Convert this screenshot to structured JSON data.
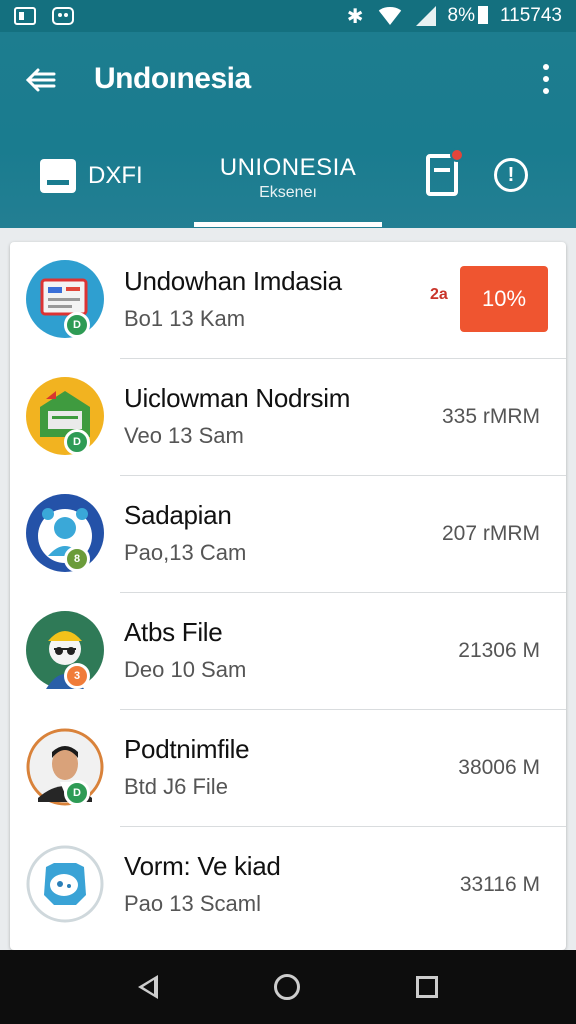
{
  "status_bar": {
    "battery": "8%",
    "time": "115743"
  },
  "app_bar": {
    "title": "Undoınesia"
  },
  "tabs": [
    {
      "label": "DXFI"
    },
    {
      "label": "UNIONESIA",
      "sub": "Ekseneı"
    }
  ],
  "list": [
    {
      "name": "Undowhan Imdasia",
      "date": "Bo1 13 Kam",
      "progress": "10%",
      "mini_label": "2a",
      "badge": "D",
      "badge_color": "#2e9b55"
    },
    {
      "name": "Uiclowman Nodrsim",
      "date": "Veo 13 Sam",
      "size": "335 rMRM",
      "badge": "D",
      "badge_color": "#2e9b55"
    },
    {
      "name": "Sadapian",
      "date": "Pao,13 Cam",
      "size": "207 rMRM",
      "badge": "8",
      "badge_color": "#6b9c3a"
    },
    {
      "name": "Atbs File",
      "date": "Deo 10 Sam",
      "size": "21306 M",
      "badge": "3",
      "badge_color": "#f07c3a"
    },
    {
      "name": "Podtnimfile",
      "date": "Btd J6 File",
      "size": "38006 M",
      "badge": "D",
      "badge_color": "#2e9b55"
    },
    {
      "name": "Vorm: Ve kiad",
      "date": "Pao 13 Scaml",
      "size": "33116 M"
    }
  ]
}
